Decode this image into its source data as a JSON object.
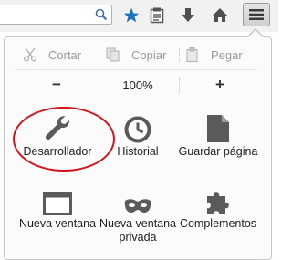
{
  "toolbar": {
    "icons": [
      "search-icon",
      "bookmark-star-icon",
      "reading-list-icon",
      "download-icon",
      "home-icon",
      "hamburger-menu-icon"
    ],
    "accent_color": "#1e73be"
  },
  "menu": {
    "edit": {
      "cut": "Cortar",
      "copy": "Copiar",
      "paste": "Pegar"
    },
    "zoom": {
      "minus": "−",
      "value": "100%",
      "plus": "+"
    },
    "items": [
      {
        "label": "Desarrollador",
        "icon": "wrench-icon"
      },
      {
        "label": "Historial",
        "icon": "clock-icon"
      },
      {
        "label": "Guardar página",
        "icon": "save-page-icon"
      },
      {
        "label": "Nueva ventana",
        "icon": "new-window-icon"
      },
      {
        "label": "Nueva ventana privada",
        "icon": "private-mask-icon"
      },
      {
        "label": "Complementos",
        "icon": "puzzle-icon"
      }
    ],
    "annotation_color": "#d2141c"
  }
}
